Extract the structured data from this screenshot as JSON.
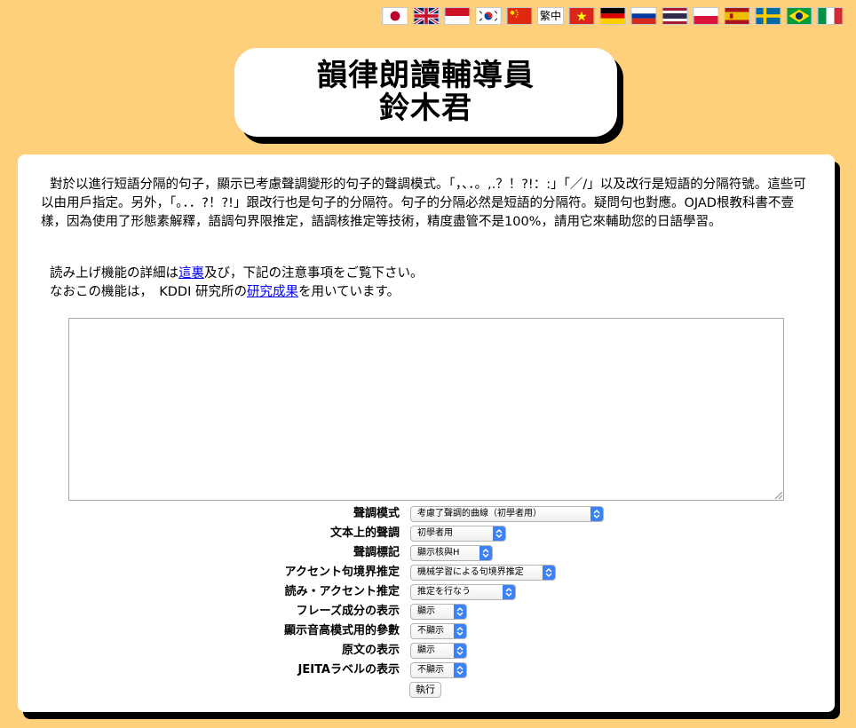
{
  "languages": [
    {
      "name": "japanese-flag"
    },
    {
      "name": "uk-flag"
    },
    {
      "name": "indonesia-flag"
    },
    {
      "name": "korea-flag"
    },
    {
      "name": "china-flag"
    },
    {
      "name": "traditional-chinese",
      "label": "繁中"
    },
    {
      "name": "vietnam-flag"
    },
    {
      "name": "germany-flag"
    },
    {
      "name": "russia-flag"
    },
    {
      "name": "thailand-flag"
    },
    {
      "name": "poland-flag"
    },
    {
      "name": "spain-flag"
    },
    {
      "name": "sweden-flag"
    },
    {
      "name": "brazil-flag"
    },
    {
      "name": "italy-flag"
    }
  ],
  "title": {
    "line1": "韻律朗讀輔導員",
    "line2": "鈴木君"
  },
  "intro": "對於以進行短語分隔的句子，顯示已考慮聲調變形的句子的聲調模式。「，、．。,.？！?!：:」「／/」以及改行是短語的分隔符號。這些可以由用戶指定。另外，「。．．?！?!」跟改行也是句子的分隔符。句子的分隔必然是短語的分隔符。疑問句也對應。OJAD根教科書不壹樣，因為使用了形態素解釋，語調句界限推定，語調核推定等技術，精度盡管不是100%，請用它來輔助您的日語學習。",
  "notes": {
    "line1_a": "読み上げ機能の詳細は",
    "line1_link": "這裏",
    "line1_b": "及び，下記の注意事項をご覧下さい。",
    "line2_a": "なおこの機能は，　KDDI 研究所の",
    "line2_link": "研究成果",
    "line2_b": "を用いています。"
  },
  "textarea": {
    "value": ""
  },
  "options": [
    {
      "label": "聲調模式",
      "value": "考慮了聲調的曲線（初學者用）"
    },
    {
      "label": "文本上的聲調",
      "value": "初學者用"
    },
    {
      "label": "聲調標記",
      "value": "顯示核與H"
    },
    {
      "label": "アクセント句境界推定",
      "value": "機械学習による句境界推定"
    },
    {
      "label": "読み・アクセント推定",
      "value": "推定を行なう"
    },
    {
      "label": "フレーズ成分の表示",
      "value": "顯示"
    },
    {
      "label": "顯示音高模式用的參數",
      "value": "不顯示"
    },
    {
      "label": "原文の表示",
      "value": "顯示"
    },
    {
      "label": "JEITAラベルの表示",
      "value": "不顯示"
    }
  ],
  "submit_label": "執行",
  "colors": {
    "background": "#ffd07c",
    "panel": "#ffffff",
    "shadow": "#000000",
    "select_arrow": "#3b82f6",
    "link": "#0000ee"
  }
}
